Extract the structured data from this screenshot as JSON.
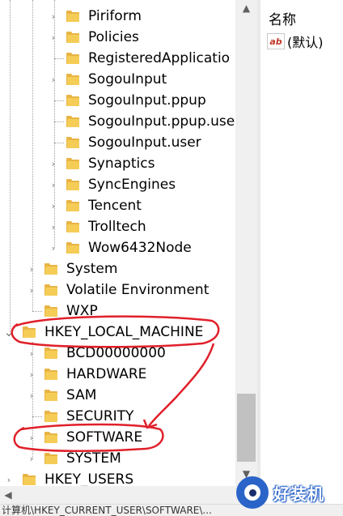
{
  "tree": {
    "items": [
      {
        "label": "Piriform",
        "expander": "›"
      },
      {
        "label": "Policies",
        "expander": "›"
      },
      {
        "label": "RegisteredApplicatio",
        "expander": ""
      },
      {
        "label": "SogouInput",
        "expander": "›"
      },
      {
        "label": "SogouInput.ppup",
        "expander": ""
      },
      {
        "label": "SogouInput.ppup.use",
        "expander": ""
      },
      {
        "label": "SogouInput.user",
        "expander": ""
      },
      {
        "label": "Synaptics",
        "expander": "›"
      },
      {
        "label": "SyncEngines",
        "expander": "›"
      },
      {
        "label": "Tencent",
        "expander": "›"
      },
      {
        "label": "Trolltech",
        "expander": "›"
      },
      {
        "label": "Wow6432Node",
        "expander": "›"
      },
      {
        "label": "System",
        "expander": "›"
      },
      {
        "label": "Volatile Environment",
        "expander": "›"
      },
      {
        "label": "WXP",
        "expander": ""
      },
      {
        "label": "HKEY_LOCAL_MACHINE",
        "expander": "⌄"
      },
      {
        "label": "BCD00000000",
        "expander": "›"
      },
      {
        "label": "HARDWARE",
        "expander": "›"
      },
      {
        "label": "SAM",
        "expander": "›"
      },
      {
        "label": "SECURITY",
        "expander": ""
      },
      {
        "label": "SOFTWARE",
        "expander": "›"
      },
      {
        "label": "SYSTEM",
        "expander": "›"
      },
      {
        "label": "HKEY_USERS",
        "expander": "›"
      }
    ]
  },
  "values_pane": {
    "column_name": "名称",
    "rows": [
      {
        "icon": "ab",
        "name": "(默认)"
      }
    ]
  },
  "scrollbar": {
    "up": "▲",
    "down": "▼",
    "left": "◀",
    "right": "▶"
  },
  "status_bar": {
    "path": "计算机\\HKEY_CURRENT_USER\\SOFTWARE\\..."
  },
  "watermark": {
    "text": "好装机"
  },
  "colors": {
    "folder": "#f5cd56",
    "annotation": "#e0202a",
    "watermark": "#2a64c8"
  }
}
